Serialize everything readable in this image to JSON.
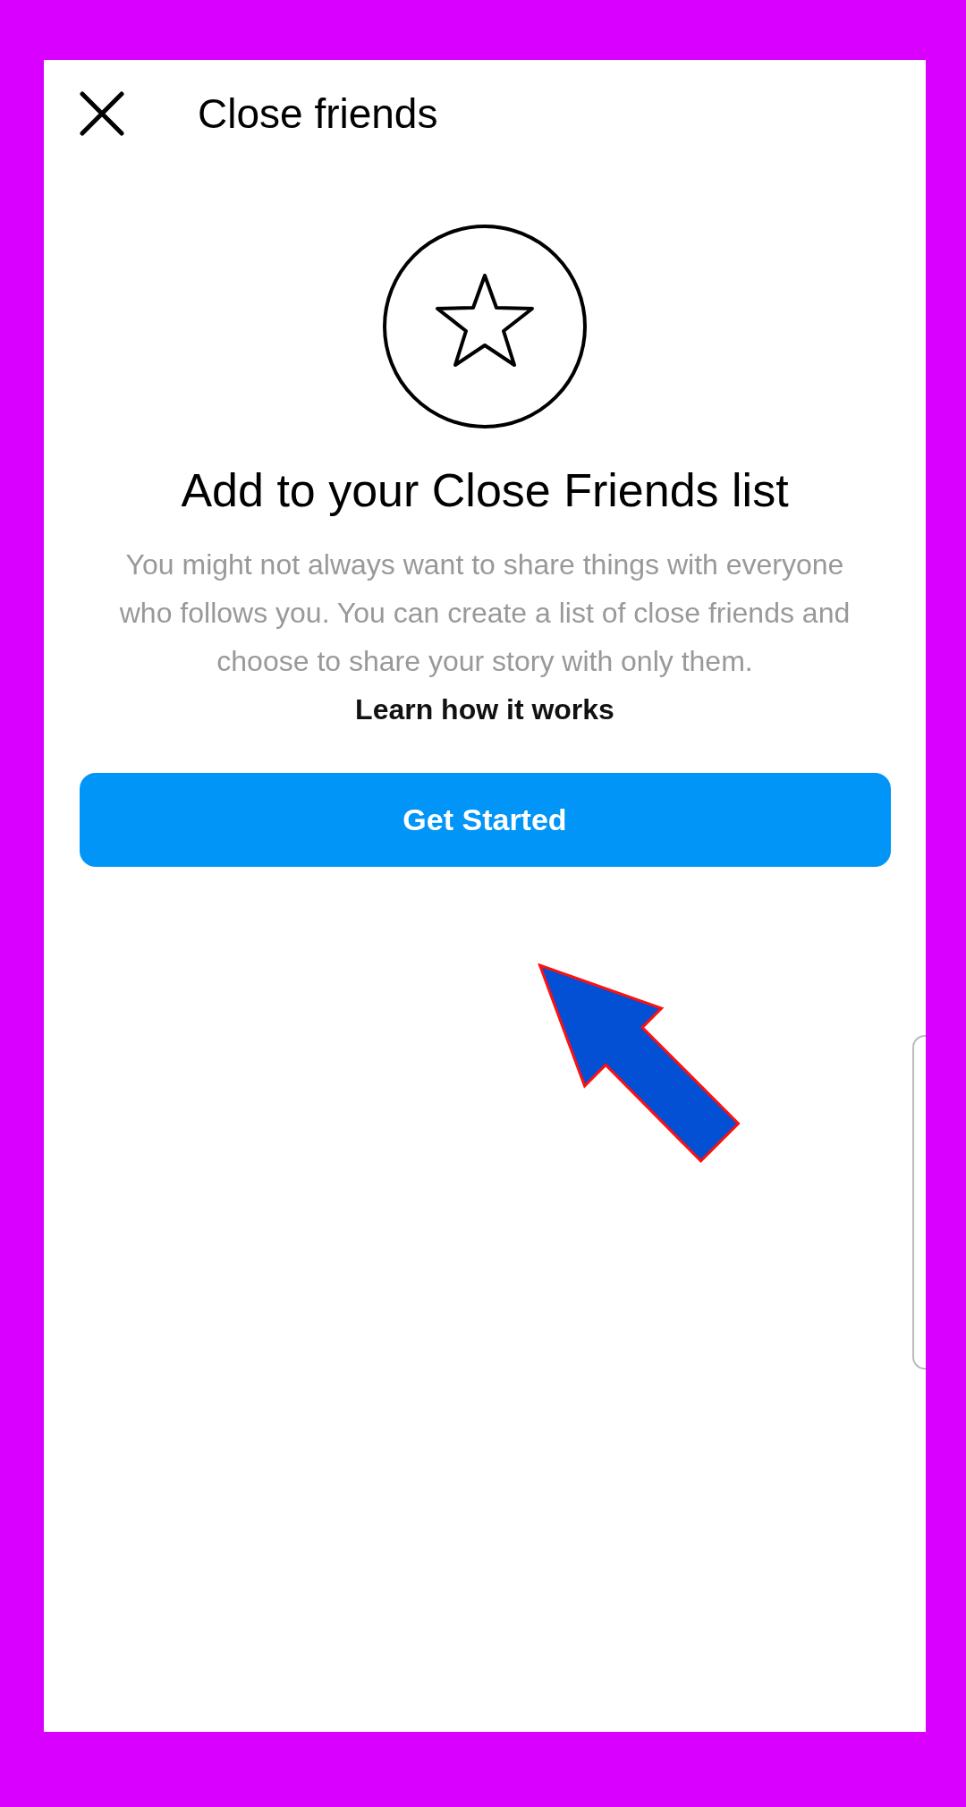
{
  "header": {
    "title": "Close friends"
  },
  "intro": {
    "heading": "Add to your Close Friends list",
    "description": "You might not always want to share things with everyone who follows you. You can create a list of close friends and choose to share your story with only them.",
    "link": "Learn how it works"
  },
  "button": {
    "label": "Get Started"
  }
}
